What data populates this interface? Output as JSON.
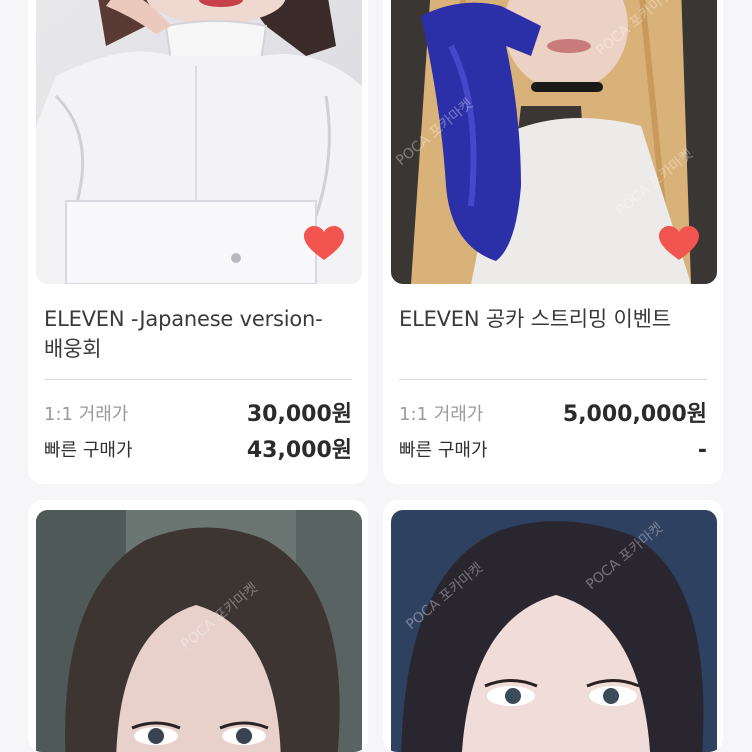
{
  "colors": {
    "background": "#f6f6f8",
    "card": "#ffffff",
    "heart": "#f2544f",
    "divider": "#d9d9dd"
  },
  "watermark": "POCA 포카마켓",
  "products": [
    {
      "title_line1": "ELEVEN -Japanese version-",
      "title_line2": "배웅회",
      "trade_label": "1:1 거래가",
      "trade_price": "30,000원",
      "quick_label": "빠른 구매가",
      "quick_price": "43,000원",
      "liked": true
    },
    {
      "title_line1": "ELEVEN 공카 스트리밍 이벤트",
      "title_line2": "",
      "trade_label": "1:1 거래가",
      "trade_price": "5,000,000원",
      "quick_label": "빠른 구매가",
      "quick_price": "-",
      "liked": true
    },
    {
      "title_line1": "",
      "title_line2": ""
    },
    {
      "title_line1": "",
      "title_line2": ""
    }
  ]
}
